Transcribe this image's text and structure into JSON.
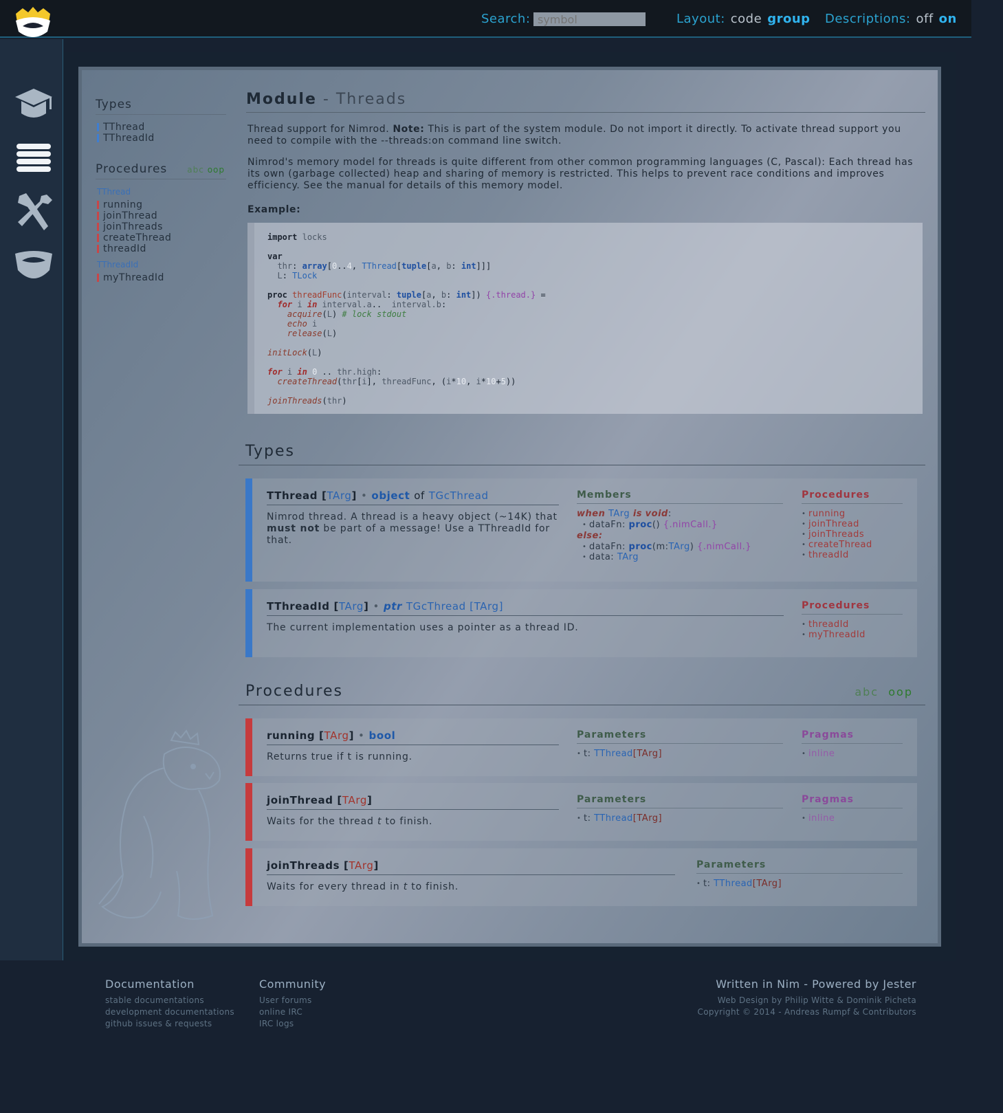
{
  "topbar": {
    "search_label": "Search:",
    "search_placeholder": "symbol",
    "layout_label": "Layout:",
    "layout_options": [
      "code",
      "group"
    ],
    "layout_selected": "group",
    "descriptions_label": "Descriptions:",
    "descriptions_options": [
      "off",
      "on"
    ],
    "descriptions_selected": "on"
  },
  "nav": {
    "icons": [
      "logo-crown-icon",
      "graduation-cap-icon",
      "list-menu-icon",
      "tools-icon",
      "crown-icon"
    ]
  },
  "sidebar": {
    "types_heading": "Types",
    "types": [
      "TThread",
      "TThreadId"
    ],
    "procedures_heading": "Procedures",
    "sort_abc": "abc",
    "sort_oop": "oop",
    "groups": [
      {
        "name": "TThread",
        "items": [
          "running",
          "joinThread",
          "joinThreads",
          "createThread",
          "threadId"
        ]
      },
      {
        "name": "TThreadId",
        "items": [
          "myThreadId"
        ]
      }
    ]
  },
  "module": {
    "title_bold": "Module",
    "title_rest": "- Threads",
    "para1_a": "Thread support for Nimrod.",
    "para1_note": "Note:",
    "para1_b": "This is part of the system module. Do not import it directly. To activate thread support you need to compile with the --threads:on command line switch.",
    "para2": "Nimrod's memory model for threads is quite different from other common programming languages (C, Pascal): Each thread has its own (garbage collected) heap and sharing of memory is restricted. This helps to prevent race conditions and improves efficiency. See the manual for details of this memory model.",
    "example_label": "Example:"
  },
  "types_section": {
    "heading": "Types",
    "cards": [
      {
        "name": "TThread",
        "generic": "TArg",
        "kind": "object",
        "of": "of",
        "base": "TGcThread",
        "desc_a": "Nimrod thread. A thread is a heavy object (~14K) that",
        "desc_b": "must not",
        "desc_c": "be part of a message! Use a TThreadId for that.",
        "members_heading": "Members",
        "when": "when",
        "when_type": "TArg",
        "is": "is",
        "void": "void",
        "colon": ":",
        "else": "else:",
        "m1_name": "dataFn:",
        "m1_proc": "proc",
        "m1_args": "()",
        "m1_pragma": "{.nimCall.}",
        "m2_name": "dataFn:",
        "m2_proc": "proc",
        "m2_args_a": "(m:",
        "m2_args_t": "TArg",
        "m2_args_b": ")",
        "m2_pragma": "{.nimCall.}",
        "m3_name": "data:",
        "m3_type": "TArg",
        "procs_heading": "Procedures",
        "procs": [
          "running",
          "joinThread",
          "joinThreads",
          "createThread",
          "threadId"
        ]
      },
      {
        "name": "TThreadId",
        "generic": "TArg",
        "kind": "ptr",
        "base": "TGcThread [TArg]",
        "desc": "The current implementation uses a pointer as a thread ID.",
        "procs_heading": "Procedures",
        "procs": [
          "threadId",
          "myThreadId"
        ]
      }
    ]
  },
  "procs_section": {
    "heading": "Procedures",
    "sort_abc": "abc",
    "sort_oop": "oop",
    "cards": [
      {
        "name": "running",
        "generic": "TArg",
        "ret": "bool",
        "desc": "Returns true if t is running.",
        "params_heading": "Parameters",
        "param_name": "t:",
        "param_type": "TThread",
        "param_gen": "[TArg]",
        "pragmas_heading": "Pragmas",
        "pragma": "inline"
      },
      {
        "name": "joinThread",
        "generic": "TArg",
        "desc_a": "Waits for the thread",
        "desc_t": "t",
        "desc_b": "to finish.",
        "params_heading": "Parameters",
        "param_name": "t:",
        "param_type": "TThread",
        "param_gen": "[TArg]",
        "pragmas_heading": "Pragmas",
        "pragma": "inline"
      },
      {
        "name": "joinThreads",
        "generic": "TArg",
        "desc_a": "Waits for every thread in",
        "desc_t": "t",
        "desc_b": "to finish.",
        "params_heading": "Parameters",
        "param_name": "t:",
        "param_type": "TThread",
        "param_gen": "[TArg]"
      }
    ]
  },
  "footer": {
    "doc_heading": "Documentation",
    "doc_links": [
      "stable documentations",
      "development documentations",
      "github issues & requests"
    ],
    "community_heading": "Community",
    "community_links": [
      "User forums",
      "online IRC",
      "IRC logs"
    ],
    "written": "Written in Nim - Powered by Jester",
    "design": "Web Design by Philip Witte & Dominik Picheta",
    "copyright": "Copyright © 2014 - Andreas Rumpf & Contributors"
  },
  "colors": {
    "accent": "#2ba3d0",
    "type_bar": "#3a78c8",
    "proc_bar": "#c63b3d"
  }
}
